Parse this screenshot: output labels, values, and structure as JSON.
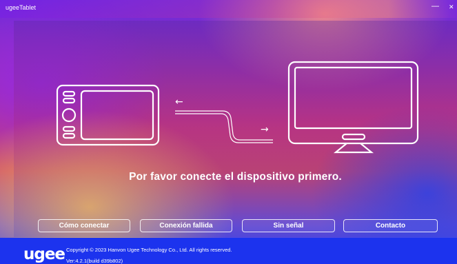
{
  "window": {
    "title": "ugeeTablet",
    "minimize_glyph": "—",
    "close_glyph": "✕"
  },
  "main": {
    "message": "Por favor conecte el dispositivo primero.",
    "illustration": {
      "tablet": "tablet-icon",
      "cable": "cable-icon",
      "monitor": "monitor-icon",
      "arrow_left": "←",
      "arrow_right": "→"
    }
  },
  "buttons": {
    "how_to_connect": "Cómo conectar",
    "connection_failed": "Conexión fallida",
    "no_signal": "Sin señal",
    "contact": "Contacto"
  },
  "footer": {
    "logo": "ugee",
    "copyright": "Copyright © 2023 Hanvon Ugee Technology Co., Ltd. All rights reserved.",
    "version": "Ver:4.2.1(build d39b802)"
  },
  "colors": {
    "footer_bg": "#1c33ee",
    "text": "#ffffff"
  }
}
